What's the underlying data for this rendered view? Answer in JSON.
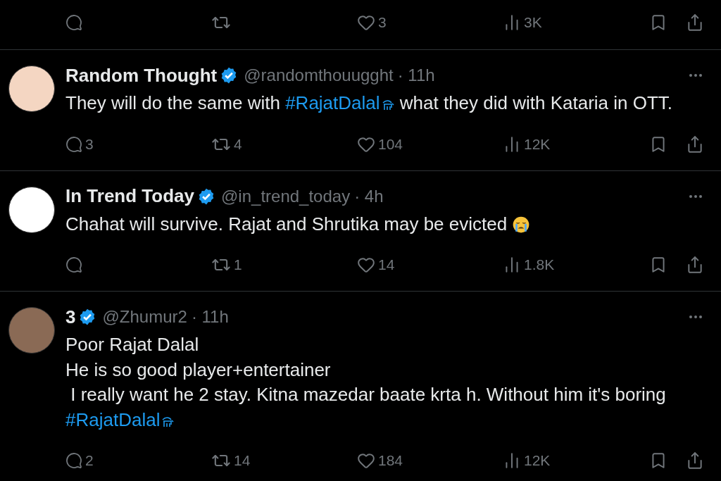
{
  "top_actions": {
    "like_count": "3",
    "view_count": "3K"
  },
  "tweets": [
    {
      "avatar": {
        "color": "#f4d6c2"
      },
      "name": "Random Thought",
      "verified": true,
      "handle": "@randomthouugght",
      "time": "· 11h",
      "lines": [
        [
          {
            "kind": "text",
            "text": "They will do the same with "
          },
          {
            "kind": "hashtag",
            "text": "#RajatDalal"
          },
          {
            "kind": "text",
            "text": " what they did with Kataria in OTT."
          }
        ]
      ],
      "actions": {
        "reply_count": "3",
        "retweet_count": "4",
        "like_count": "104",
        "view_count": "12K"
      }
    },
    {
      "avatar": {
        "color": "#ffffff"
      },
      "name": "In Trend Today",
      "verified": true,
      "handle": "@in_trend_today",
      "time": "· 4h",
      "lines": [
        [
          {
            "kind": "text",
            "text": "Chahat will survive. Rajat and Shrutika may be evicted "
          },
          {
            "kind": "emoji"
          }
        ]
      ],
      "actions": {
        "retweet_count": "1",
        "like_count": "14",
        "view_count": "1.8K"
      }
    },
    {
      "avatar": {
        "color": "#8a6a55"
      },
      "name": "3",
      "verified": true,
      "handle": "@Zhumur2",
      "time": "· 11h",
      "lines": [
        [
          {
            "kind": "text",
            "text": "Poor Rajat Dalal"
          }
        ],
        [
          {
            "kind": "text",
            "text": "He is so good player+entertainer"
          }
        ],
        [
          {
            "kind": "text",
            "text": " I really want he 2 stay. Kitna mazedar baate krta h. Without him it's boring"
          }
        ],
        [
          {
            "kind": "hashtag",
            "text": "#RajatDalal"
          }
        ]
      ],
      "actions": {
        "reply_count": "2",
        "retweet_count": "14",
        "like_count": "184",
        "view_count": "12K"
      }
    }
  ]
}
